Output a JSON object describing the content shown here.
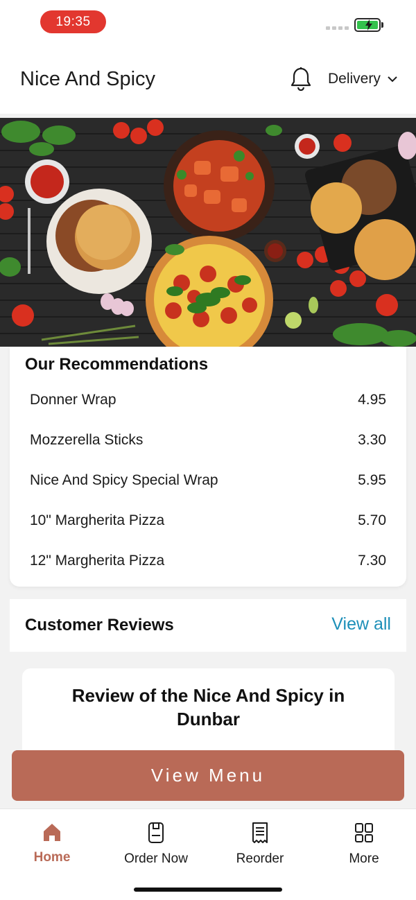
{
  "status_bar": {
    "time": "19:35"
  },
  "header": {
    "title": "Nice And Spicy",
    "delivery_label": "Delivery"
  },
  "recommendations": {
    "title": "Our Recommendations",
    "items": [
      {
        "name": "Donner Wrap",
        "price": "4.95"
      },
      {
        "name": "Mozzerella Sticks",
        "price": "3.30"
      },
      {
        "name": "Nice And Spicy Special Wrap",
        "price": "5.95"
      },
      {
        "name": "10\" Margherita Pizza",
        "price": "5.70"
      },
      {
        "name": "12\" Margherita Pizza",
        "price": "7.30"
      }
    ]
  },
  "reviews": {
    "title": "Customer Reviews",
    "view_all": "View all",
    "card_title": "Review of the Nice And Spicy in Dunbar"
  },
  "cta": {
    "label": "View Menu"
  },
  "nav": {
    "items": [
      {
        "label": "Home",
        "icon": "home-icon"
      },
      {
        "label": "Order Now",
        "icon": "order-icon"
      },
      {
        "label": "Reorder",
        "icon": "receipt-icon"
      },
      {
        "label": "More",
        "icon": "grid-icon"
      }
    ]
  },
  "colors": {
    "accent": "#b96a57",
    "link": "#1d8fb8",
    "time_pill": "#e2372f",
    "battery": "#33c24d"
  }
}
